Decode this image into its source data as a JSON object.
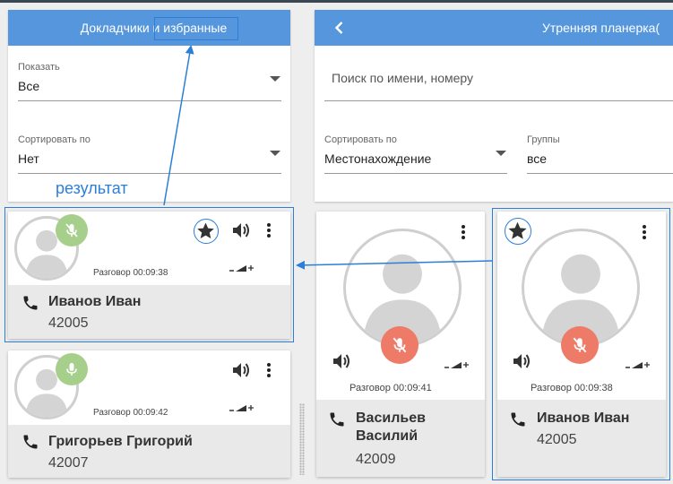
{
  "left_panel": {
    "title_prefix": "Докладчики и ",
    "title_highlight": "избранные",
    "show_label": "Показать",
    "show_value": "Все",
    "sort_label": "Сортировать по",
    "sort_value": "Нет"
  },
  "right_panel": {
    "title": "Утренняя планерка(",
    "search_placeholder": "Поиск по имени, номеру",
    "sort_label": "Сортировать по",
    "sort_value": "Местонахождение",
    "groups_label": "Группы",
    "groups_value": "все"
  },
  "annotation": {
    "text": "результат"
  },
  "left_cards": [
    {
      "name": "Иванов Иван",
      "number": "42005",
      "call_time": "Разговор 00:09:38",
      "mic_state": "muted",
      "favorite": true
    },
    {
      "name": "Григорьев Григорий",
      "number": "42007",
      "call_time": "Разговор 00:09:42",
      "mic_state": "active",
      "favorite": false
    }
  ],
  "right_cards": [
    {
      "name": "Васильев Василий",
      "number": "42009",
      "call_time": "Разговор 00:09:41",
      "mic_state": "muted",
      "favorite": false
    },
    {
      "name": "Иванов Иван",
      "number": "42005",
      "call_time": "Разговор 00:09:38",
      "mic_state": "muted",
      "favorite": true
    }
  ],
  "colors": {
    "header_blue": "#5596dc",
    "highlight_blue": "#2b7fd9",
    "mic_active_green": "#a6cf8c",
    "mic_muted_red": "#ee7b67",
    "footer_gray": "#e9e9e9"
  },
  "icons": {
    "back": "chevron-left-icon",
    "favorite": "star-icon",
    "volume": "volume-icon",
    "menu": "more-vertical-icon",
    "signal": "signal-icon",
    "mic": "microphone-icon",
    "mic_off": "microphone-off-icon",
    "phone": "phone-icon",
    "avatar": "person-avatar-icon"
  }
}
